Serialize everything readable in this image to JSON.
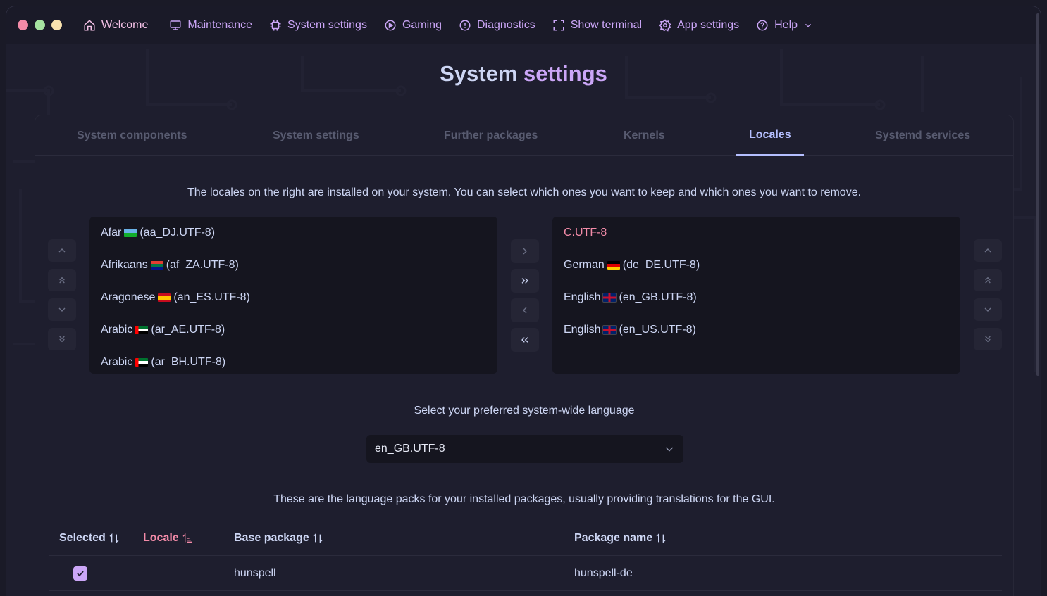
{
  "window": {
    "traffic_colors": [
      "#f38ba8",
      "#a6e3a1",
      "#f9e2af"
    ]
  },
  "nav": [
    {
      "label": "Welcome",
      "icon": "home-icon",
      "color": "#f5c2e7"
    },
    {
      "label": "Maintenance",
      "icon": "monitor-icon",
      "color": "#cba6f7"
    },
    {
      "label": "System settings",
      "icon": "cpu-icon",
      "color": "#cba6f7"
    },
    {
      "label": "Gaming",
      "icon": "play-circle-icon",
      "color": "#cba6f7"
    },
    {
      "label": "Diagnostics",
      "icon": "info-icon",
      "color": "#cba6f7"
    },
    {
      "label": "Show terminal",
      "icon": "fullscreen-icon",
      "color": "#cba6f7"
    },
    {
      "label": "App settings",
      "icon": "gear-icon",
      "color": "#cba6f7"
    },
    {
      "label": "Help",
      "icon": "help-circle-icon",
      "color": "#cba6f7"
    }
  ],
  "page": {
    "title_part1": "System",
    "title_part2": "settings"
  },
  "tabs": [
    {
      "label": "System components",
      "active": false
    },
    {
      "label": "System settings",
      "active": false
    },
    {
      "label": "Further packages",
      "active": false
    },
    {
      "label": "Kernels",
      "active": false
    },
    {
      "label": "Locales",
      "active": true
    },
    {
      "label": "Systemd services",
      "active": false
    }
  ],
  "locales": {
    "description": "The locales on the right are installed on your system. You can select which ones you want to keep and which ones you want to remove.",
    "available": [
      {
        "name": "Afar",
        "flag": "dj",
        "code": "(aa_DJ.UTF-8)"
      },
      {
        "name": "Afrikaans",
        "flag": "za",
        "code": "(af_ZA.UTF-8)"
      },
      {
        "name": "Aragonese",
        "flag": "es",
        "code": "(an_ES.UTF-8)"
      },
      {
        "name": "Arabic",
        "flag": "ae",
        "code": "(ar_AE.UTF-8)"
      },
      {
        "name": "Arabic",
        "flag": "ae",
        "code": "(ar_BH.UTF-8)"
      }
    ],
    "installed": [
      {
        "name": "C.UTF-8",
        "flag": "",
        "code": "",
        "highlight": true
      },
      {
        "name": "German",
        "flag": "de",
        "code": "(de_DE.UTF-8)",
        "highlight": false
      },
      {
        "name": "English",
        "flag": "gb",
        "code": "(en_GB.UTF-8)",
        "highlight": false
      },
      {
        "name": "English",
        "flag": "gb",
        "code": "(en_US.UTF-8)",
        "highlight": false
      }
    ],
    "language_label": "Select your preferred system-wide language",
    "language_value": "en_GB.UTF-8",
    "packs_description": "These are the language packs for your installed packages, usually providing translations for the GUI."
  },
  "table": {
    "headers": [
      "Selected",
      "Locale",
      "Base package",
      "Package name"
    ],
    "rows": [
      {
        "selected": true,
        "locale": "",
        "base_package": "hunspell",
        "package_name": "hunspell-de"
      }
    ]
  }
}
